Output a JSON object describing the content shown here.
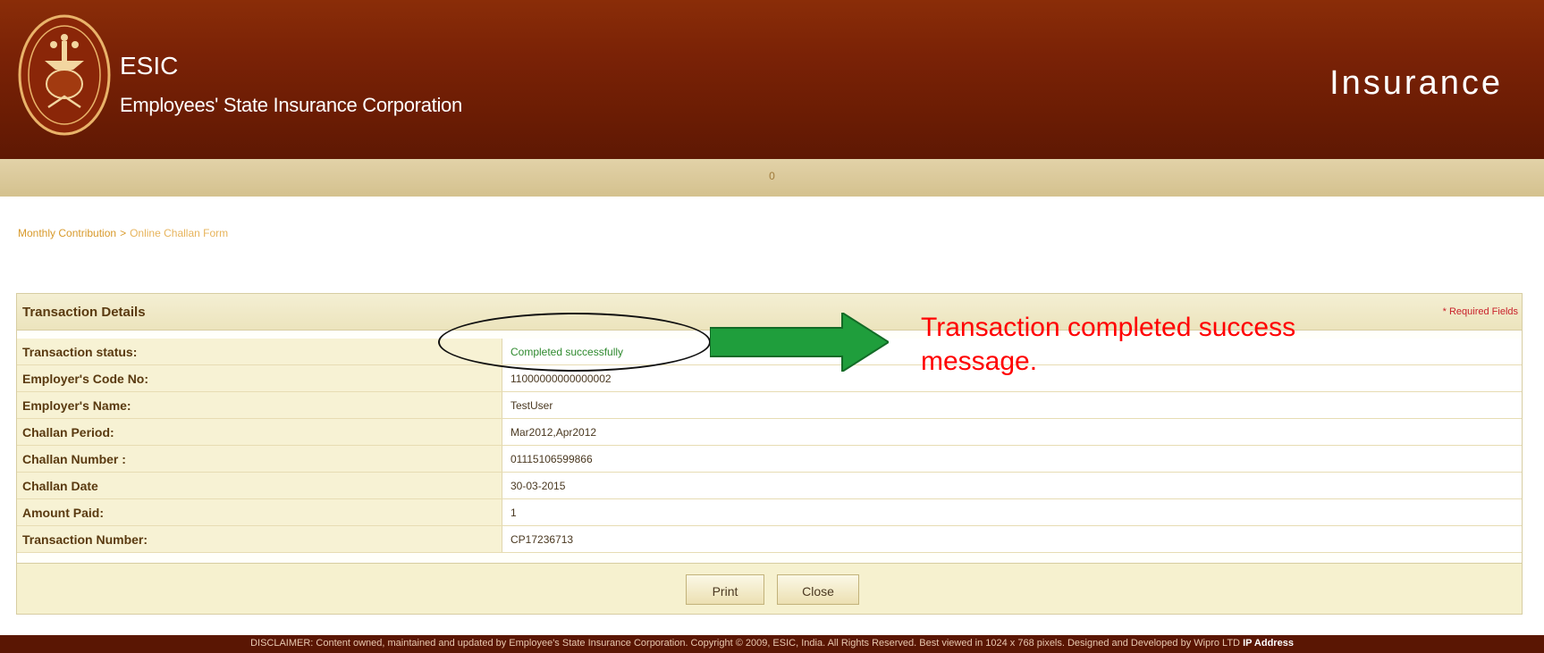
{
  "header": {
    "brand": "ESIC",
    "org_name": "Employees' State Insurance Corporation",
    "section_title": "Insurance",
    "logo_icon": "esic-emblem-icon",
    "colors": {
      "header_bg": "#7a2206",
      "subbar_bg": "#d4c18e",
      "footer_bg": "#5a1603"
    }
  },
  "subbar": {
    "text": "0"
  },
  "breadcrumb": {
    "parent": "Monthly Contribution",
    "separator": ">",
    "current": "Online Challan Form"
  },
  "panel": {
    "title": "Transaction Details",
    "required_note": "* Required Fields",
    "rows": [
      {
        "label": "Transaction status:",
        "value": "Completed successfully"
      },
      {
        "label": "Employer's Code No:",
        "value": "11000000000000002"
      },
      {
        "label": "Employer's Name:",
        "value": "TestUser"
      },
      {
        "label": "Challan Period:",
        "value": "Mar2012,Apr2012"
      },
      {
        "label": "Challan Number :",
        "value": "01115106599866"
      },
      {
        "label": "Challan Date",
        "value": "30-03-2015"
      },
      {
        "label": "Amount Paid:",
        "value": "1"
      },
      {
        "label": "Transaction Number:",
        "value": "CP17236713"
      }
    ],
    "buttons": {
      "print": "Print",
      "close": "Close"
    }
  },
  "footer": {
    "disclaimer": "DISCLAIMER: Content owned, maintained and updated by Employee's State Insurance Corporation. Copyright © 2009, ESIC, India. All Rights Reserved. Best viewed in 1024 x 768 pixels. Designed and Developed by Wipro LTD",
    "ip_label": "IP Address"
  },
  "annotation": {
    "text": "Transaction completed success message.",
    "arrow_icon": "right-arrow-icon",
    "text_color": "#ff0000",
    "arrow_color": "#1f9e3c"
  }
}
